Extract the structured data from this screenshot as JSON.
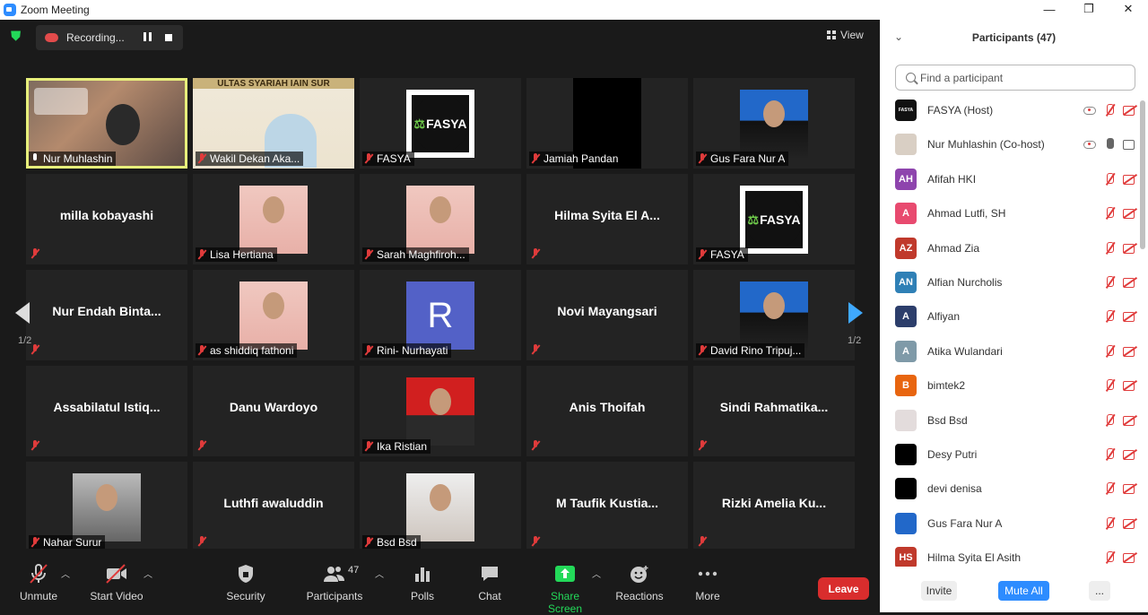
{
  "window": {
    "title": "Zoom Meeting",
    "controls": {
      "minimize": "—",
      "restore": "❐",
      "close": "✕"
    }
  },
  "meeting": {
    "recording_label": "Recording...",
    "view_label": "View",
    "page_left": "1/2",
    "page_right": "1/2"
  },
  "tiles": [
    {
      "label": "Nur Muhlashin",
      "type": "video"
    },
    {
      "label": "Wakil Dekan Aka...",
      "type": "video"
    },
    {
      "label": "FASYA",
      "type": "logo"
    },
    {
      "label": "Jamiah Pandan",
      "type": "black"
    },
    {
      "label": "Gus Fara Nur A",
      "type": "photo"
    },
    {
      "name": "milla kobayashi",
      "type": "name"
    },
    {
      "label": "Lisa Hertiana",
      "type": "photo"
    },
    {
      "label": "Sarah Maghfiroh...",
      "type": "photo"
    },
    {
      "name": "Hilma Syita El A...",
      "type": "name"
    },
    {
      "label": "FASYA",
      "type": "logo"
    },
    {
      "name": "Nur Endah Binta...",
      "type": "name"
    },
    {
      "label": "as shiddiq fathoni",
      "type": "photo"
    },
    {
      "label": "Rini- Nurhayati",
      "type": "letter",
      "letter": "R"
    },
    {
      "name": "Novi Mayangsari",
      "type": "name"
    },
    {
      "label": "David Rino Tripuj...",
      "type": "photo"
    },
    {
      "name": "Assabilatul Istiq...",
      "type": "name"
    },
    {
      "name": "Danu Wardoyo",
      "type": "name"
    },
    {
      "label": "Ika Ristian",
      "type": "photo"
    },
    {
      "name": "Anis Thoifah",
      "type": "name"
    },
    {
      "name": "Sindi Rahmatika...",
      "type": "name"
    },
    {
      "label": "Nahar Surur",
      "type": "photo"
    },
    {
      "name": "Luthfi awaluddin",
      "type": "name"
    },
    {
      "label": "Bsd Bsd",
      "type": "photo"
    },
    {
      "name": "M Taufik Kustia...",
      "type": "name"
    },
    {
      "name": "Rizki Amelia Ku...",
      "type": "name"
    }
  ],
  "banner_text": "ULTAS SYARIAH IAIN SUR",
  "logo_text": "FASYA",
  "toolbar": {
    "unmute": "Unmute",
    "start_video": "Start Video",
    "security": "Security",
    "participants": "Participants",
    "participants_count": "47",
    "polls": "Polls",
    "chat": "Chat",
    "share_screen": "Share Screen",
    "reactions": "Reactions",
    "more": "More",
    "leave": "Leave"
  },
  "panel": {
    "title": "Participants (47)",
    "search_placeholder": "Find a participant",
    "invite": "Invite",
    "mute_all": "Mute All",
    "more": "...",
    "participants": [
      {
        "initials": "FASYA",
        "name": "FASYA (Host)",
        "color": "#111111"
      },
      {
        "initials": "",
        "name": "Nur Muhlashin (Co-host)",
        "color": "#d9cfc4"
      },
      {
        "initials": "AH",
        "name": "Afifah HKI",
        "color": "#8e44ad"
      },
      {
        "initials": "A",
        "name": "Ahmad Lutfi, SH",
        "color": "#e84a6f"
      },
      {
        "initials": "AZ",
        "name": "Ahmad Zia",
        "color": "#c0392b"
      },
      {
        "initials": "AN",
        "name": "Alfian Nurcholis",
        "color": "#2f80b6"
      },
      {
        "initials": "A",
        "name": "Alfiyan",
        "color": "#2c3e6b"
      },
      {
        "initials": "A",
        "name": "Atika Wulandari",
        "color": "#7f9aa8"
      },
      {
        "initials": "B",
        "name": "bimtek2",
        "color": "#e8650f"
      },
      {
        "initials": "",
        "name": "Bsd Bsd",
        "color": "#e3dcdc"
      },
      {
        "initials": "",
        "name": "Desy Putri",
        "color": "#000000"
      },
      {
        "initials": "",
        "name": "devi denisa",
        "color": "#000000"
      },
      {
        "initials": "",
        "name": "Gus Fara Nur A",
        "color": "#2268c9"
      },
      {
        "initials": "HS",
        "name": "Hilma Syita El Asith",
        "color": "#c0392b"
      }
    ]
  }
}
